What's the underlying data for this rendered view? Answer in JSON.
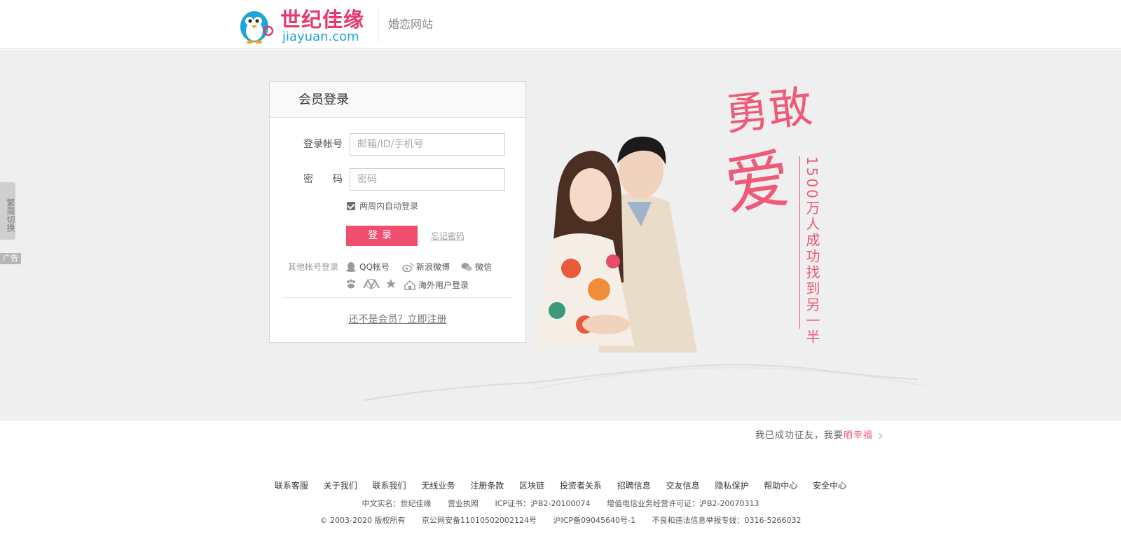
{
  "header": {
    "logo_cn": "世纪佳缘",
    "logo_en": "jiayuan.com",
    "subtitle": "婚恋网站"
  },
  "side": {
    "switch_label": "繁简切换",
    "ad_label": "广告"
  },
  "login": {
    "title": "会员登录",
    "account_label": "登录帐号",
    "account_placeholder": "邮箱/ID/手机号",
    "password_label": "密　　码",
    "password_placeholder": "密码",
    "remember_label": "两周内自动登录",
    "remember_checked": true,
    "submit_label": "登录",
    "forgot_label": "忘记密码",
    "other_label": "其他帐号登录",
    "social": [
      {
        "icon": "qq-icon",
        "label": "QQ帐号"
      },
      {
        "icon": "weibo-icon",
        "label": "新浪微博"
      },
      {
        "icon": "wechat-icon",
        "label": "微信"
      },
      {
        "icon": "baidu-icon",
        "label": ""
      },
      {
        "icon": "renren-icon",
        "label": ""
      },
      {
        "icon": "star-icon",
        "label": ""
      },
      {
        "icon": "overseas-icon",
        "label": "海外用户登录"
      }
    ],
    "register_label": "还不是会员？立即注册"
  },
  "hero": {
    "slogan_1": "勇敢",
    "slogan_2": "爱",
    "slogan_vertical": "1500万人成功找到另一半",
    "accent_color": "#ee5a78",
    "button_color": "#f04e6e"
  },
  "testimonial": {
    "prefix": "我已成功征友，我要",
    "highlight": "晒幸福"
  },
  "footer": {
    "links": [
      "联系客服",
      "关于我们",
      "联系我们",
      "无线业务",
      "注册条款",
      "区块链",
      "投资者关系",
      "招聘信息",
      "交友信息",
      "隐私保护",
      "帮助中心",
      "安全中心"
    ],
    "line2": {
      "name": "中文实名：世纪佳缘",
      "license": "营业执照",
      "icp": "ICP证书：沪B2-20100074",
      "telecom": "增值电信业务经营许可证：沪B2-20070313"
    },
    "line3": {
      "copyright": "©  2003-2020  版权所有",
      "police": "京公网安备11010502002124号",
      "icp_record": "沪ICP备09045640号-1",
      "report": "不良和违法信息举报专线：0316-5266032"
    }
  }
}
